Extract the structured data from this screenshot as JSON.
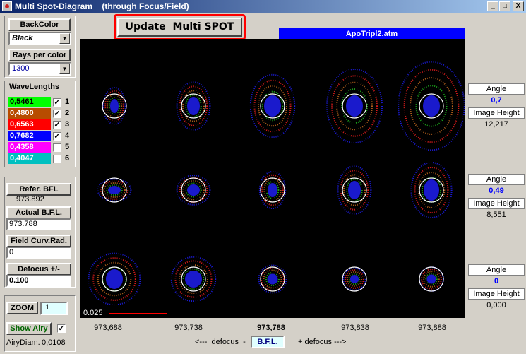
{
  "window": {
    "title": "Multi Spot-Diagram    (through Focus/Field)",
    "buttons": [
      "_",
      "□",
      "X"
    ]
  },
  "update_button": "Update  Multi SPOT",
  "file_name": "ApoTripl2.atm",
  "backcolor": {
    "label": "BackColor",
    "value": "Black"
  },
  "rays": {
    "label": "Rays per color",
    "value": "1300"
  },
  "wavelengths": {
    "label": "WaveLengths",
    "items": [
      {
        "value": "0,5461",
        "index": "1",
        "checked": true,
        "bg": "#00ff00",
        "fg": "#000000"
      },
      {
        "value": "0,4800",
        "index": "2",
        "checked": true,
        "bg": "#b84c00",
        "fg": "#ffffff"
      },
      {
        "value": "0,6563",
        "index": "3",
        "checked": true,
        "bg": "#ff0000",
        "fg": "#ffffff"
      },
      {
        "value": "0,7682",
        "index": "4",
        "checked": true,
        "bg": "#0000ff",
        "fg": "#ffffff"
      },
      {
        "value": "0,4358",
        "index": "5",
        "checked": false,
        "bg": "#ff00ff",
        "fg": "#ffffff"
      },
      {
        "value": "0,4047",
        "index": "6",
        "checked": false,
        "bg": "#00c0c0",
        "fg": "#ffffff"
      }
    ]
  },
  "refer_bfl": {
    "label": "Refer.  BFL",
    "value": "973.892"
  },
  "actual_bfl": {
    "label": "Actual  B.F.L.",
    "value": "973.788"
  },
  "field_curv": {
    "label": "Field Curv.Rad.",
    "value": "0"
  },
  "defocus": {
    "label": "Defocus +/-",
    "value": "0.100"
  },
  "zoom": {
    "label": "ZOOM",
    "value": ".1"
  },
  "show_airy": {
    "label": "Show Airy",
    "checked": true
  },
  "airy_diam": {
    "label": "AiryDiam.",
    "value": "0,0108"
  },
  "scale_label": "0.025",
  "bfl_values": [
    "973,688",
    "973,738",
    "973,788",
    "973,838",
    "973,888"
  ],
  "nav": {
    "left": "<---  defocus  -",
    "center": "B.F.L.",
    "right": "+ defocus --->"
  },
  "angles": [
    {
      "angle_label": "Angle",
      "angle": "0,7",
      "height_label": "Image Height",
      "height": "12,217"
    },
    {
      "angle_label": "Angle",
      "angle": "0,49",
      "height_label": "Image Height",
      "height": "8,551"
    },
    {
      "angle_label": "Angle",
      "angle": "0",
      "height_label": "Image Height",
      "height": "0,000"
    }
  ],
  "colors": {
    "accent_blue": "#0000ff",
    "title_blue": "#0a246a",
    "update_border": "#ff0000"
  }
}
